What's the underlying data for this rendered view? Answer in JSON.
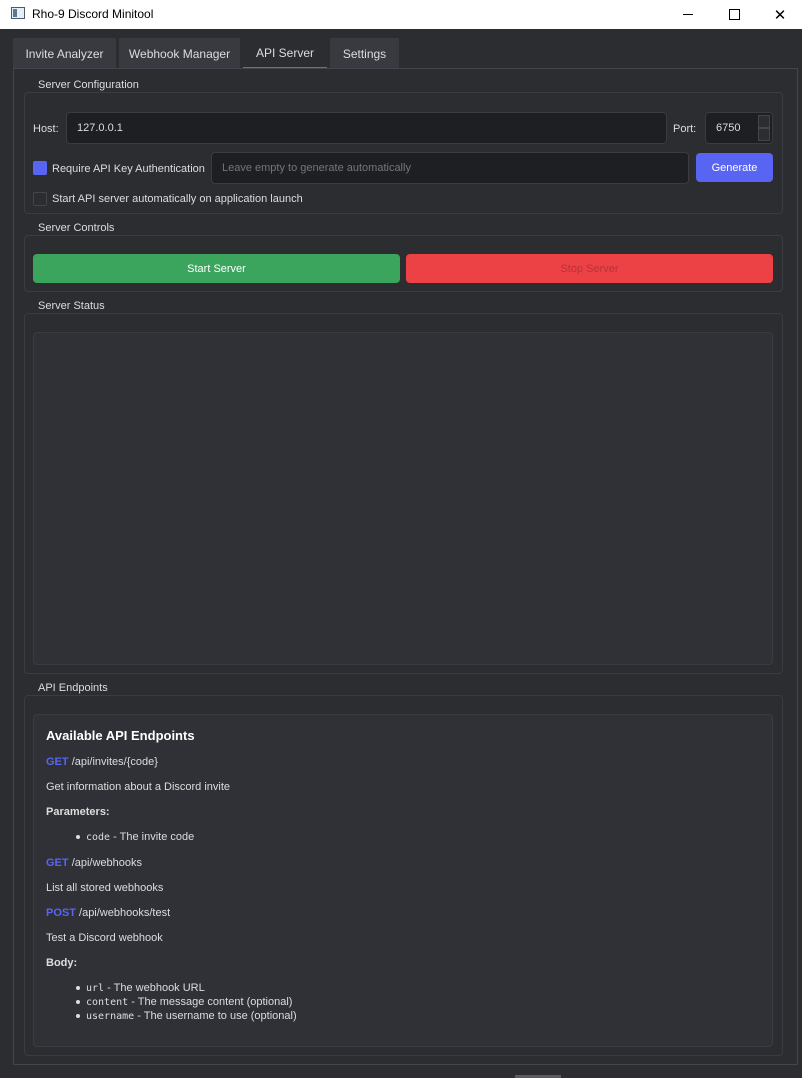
{
  "window": {
    "title": "Rho-9 Discord Minitool"
  },
  "tabs": [
    {
      "label": "Invite Analyzer"
    },
    {
      "label": "Webhook Manager"
    },
    {
      "label": "API Server"
    },
    {
      "label": "Settings"
    }
  ],
  "server_config": {
    "group_label": "Server Configuration",
    "host_label": "Host:",
    "host_value": "127.0.0.1",
    "port_label": "Port:",
    "port_value": "6750",
    "require_key_label": "Require API Key Authentication",
    "require_key_checked": true,
    "api_key_placeholder": "Leave empty to generate automatically",
    "generate_label": "Generate",
    "autostart_label": "Start API server automatically on application launch",
    "autostart_checked": false
  },
  "server_controls": {
    "group_label": "Server Controls",
    "start_label": "Start Server",
    "stop_label": "Stop Server"
  },
  "server_status": {
    "group_label": "Server Status",
    "content": ""
  },
  "api_endpoints": {
    "group_label": "API Endpoints",
    "title": "Available API Endpoints",
    "endpoints": [
      {
        "method": "GET",
        "path": "/api/invites/{code}",
        "description": "Get information about a Discord invite",
        "section_label": "Parameters:",
        "params": [
          {
            "name": "code",
            "desc": " - The invite code"
          }
        ]
      },
      {
        "method": "GET",
        "path": "/api/webhooks",
        "description": "List all stored webhooks"
      },
      {
        "method": "POST",
        "path": "/api/webhooks/test",
        "description": "Test a Discord webhook",
        "section_label": "Body:",
        "params": [
          {
            "name": "url",
            "desc": " - The webhook URL"
          },
          {
            "name": "content",
            "desc": " - The message content (optional)"
          },
          {
            "name": "username",
            "desc": " - The username to use (optional)"
          }
        ]
      }
    ]
  },
  "colors": {
    "accent": "#5865f2",
    "start_button": "#3ba55d",
    "stop_button": "#ed4245",
    "background": "#2b2d31"
  }
}
